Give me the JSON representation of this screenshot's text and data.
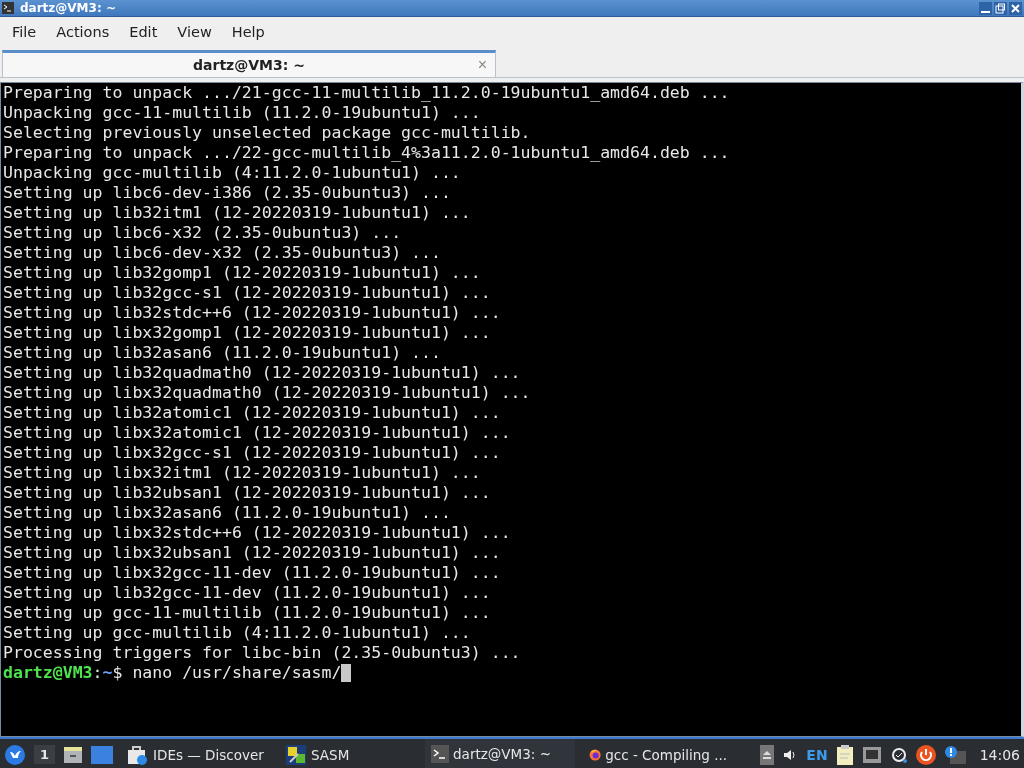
{
  "window": {
    "title": "dartz@VM3: ~"
  },
  "menu": [
    "File",
    "Actions",
    "Edit",
    "View",
    "Help"
  ],
  "tabs": [
    {
      "label": "dartz@VM3: ~",
      "selected": true,
      "close": "×"
    }
  ],
  "terminal": {
    "lines": [
      "Preparing to unpack .../21-gcc-11-multilib_11.2.0-19ubuntu1_amd64.deb ...",
      "Unpacking gcc-11-multilib (11.2.0-19ubuntu1) ...",
      "Selecting previously unselected package gcc-multilib.",
      "Preparing to unpack .../22-gcc-multilib_4%3a11.2.0-1ubuntu1_amd64.deb ...",
      "Unpacking gcc-multilib (4:11.2.0-1ubuntu1) ...",
      "Setting up libc6-dev-i386 (2.35-0ubuntu3) ...",
      "Setting up lib32itm1 (12-20220319-1ubuntu1) ...",
      "Setting up libc6-x32 (2.35-0ubuntu3) ...",
      "Setting up libc6-dev-x32 (2.35-0ubuntu3) ...",
      "Setting up lib32gomp1 (12-20220319-1ubuntu1) ...",
      "Setting up lib32gcc-s1 (12-20220319-1ubuntu1) ...",
      "Setting up lib32stdc++6 (12-20220319-1ubuntu1) ...",
      "Setting up libx32gomp1 (12-20220319-1ubuntu1) ...",
      "Setting up lib32asan6 (11.2.0-19ubuntu1) ...",
      "Setting up lib32quadmath0 (12-20220319-1ubuntu1) ...",
      "Setting up libx32quadmath0 (12-20220319-1ubuntu1) ...",
      "Setting up lib32atomic1 (12-20220319-1ubuntu1) ...",
      "Setting up libx32atomic1 (12-20220319-1ubuntu1) ...",
      "Setting up libx32gcc-s1 (12-20220319-1ubuntu1) ...",
      "Setting up libx32itm1 (12-20220319-1ubuntu1) ...",
      "Setting up lib32ubsan1 (12-20220319-1ubuntu1) ...",
      "Setting up libx32asan6 (11.2.0-19ubuntu1) ...",
      "Setting up libx32stdc++6 (12-20220319-1ubuntu1) ...",
      "Setting up libx32ubsan1 (12-20220319-1ubuntu1) ...",
      "Setting up libx32gcc-11-dev (11.2.0-19ubuntu1) ...",
      "Setting up lib32gcc-11-dev (11.2.0-19ubuntu1) ...",
      "Setting up gcc-11-multilib (11.2.0-19ubuntu1) ...",
      "Setting up gcc-multilib (4:11.2.0-1ubuntu1) ...",
      "Processing triggers for libc-bin (2.35-0ubuntu3) ..."
    ],
    "prompt": {
      "user_host": "dartz@VM3",
      "separator": ":",
      "path": "~",
      "command": "$ nano /usr/share/sasm/"
    }
  },
  "taskbar": {
    "desktop": "1",
    "tasks": [
      {
        "label": "IDEs — Discover",
        "kind": "discover",
        "selected": false
      },
      {
        "label": "SASM",
        "kind": "sasm",
        "selected": false
      },
      {
        "label": "dartz@VM3: ~",
        "kind": "terminal",
        "selected": true
      },
      {
        "label": "gcc - Compiling ...",
        "kind": "firefox",
        "selected": false
      }
    ],
    "language": "EN",
    "clock": "14:06"
  }
}
